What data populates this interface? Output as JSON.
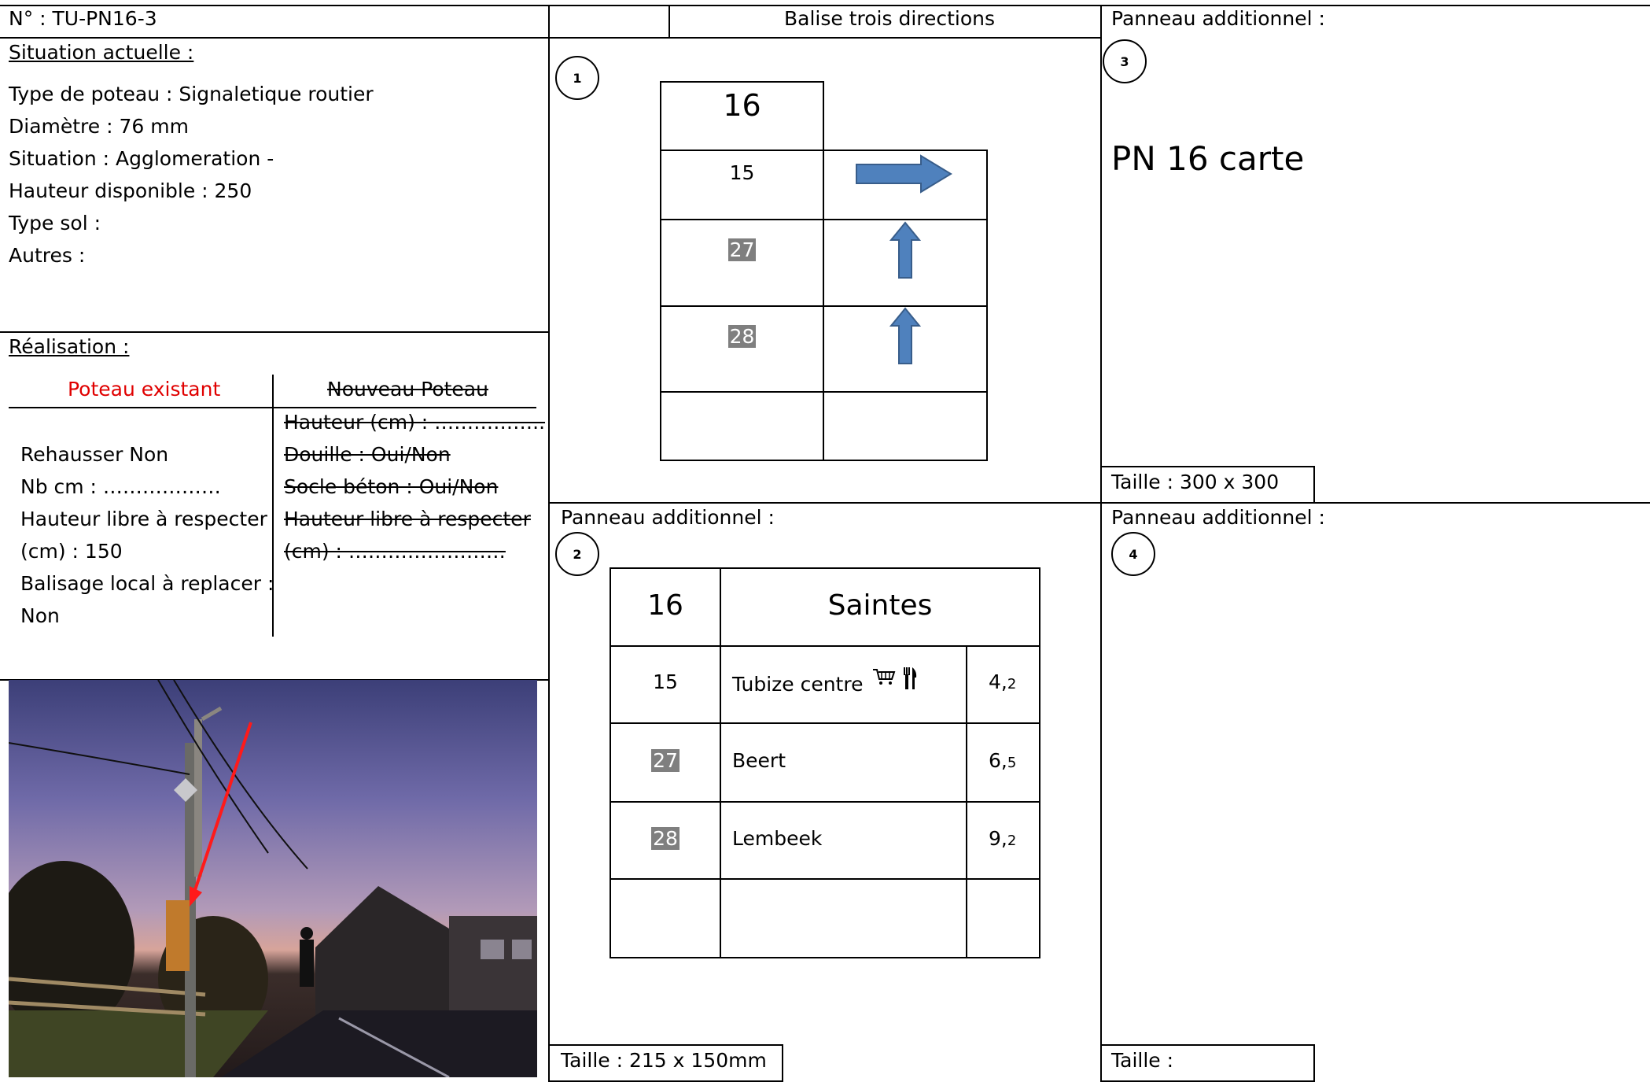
{
  "header": {
    "numero": "N° : TU-PN16-3",
    "balise_title": "Balise trois directions",
    "panneau3_title": "Panneau additionnel :"
  },
  "situation": {
    "heading": "Situation actuelle :",
    "lines": [
      "Type de poteau : Signaletique routier",
      "Diamètre : 76 mm",
      "Situation : Agglomeration -",
      "Hauteur disponible : 250",
      "Type sol :",
      "Autres :"
    ]
  },
  "realisation": {
    "heading": "Réalisation :",
    "col_existing": "Poteau existant",
    "col_new": "Nouveau Poteau",
    "existing_lines": [
      "Rehausser  Non",
      "Nb cm : ………………",
      "Hauteur libre à respecter",
      "(cm) : 150",
      "Balisage local à replacer :",
      " Non"
    ],
    "new_lines": [
      "Hauteur (cm) : ……………..",
      "Douille : Oui/Non",
      "Socle béton : Oui/Non",
      "Hauteur libre à respecter",
      "(cm) : ……………………"
    ]
  },
  "panel1": {
    "number": "1",
    "top": "16",
    "rows": [
      {
        "label": "15",
        "arrow": "right-arrow-icon"
      },
      {
        "label": "27",
        "arrow": "up-arrow-icon"
      },
      {
        "label": "28",
        "arrow": "up-arrow-icon"
      },
      {
        "label": "",
        "arrow": ""
      }
    ]
  },
  "panel2": {
    "title": "Panneau additionnel :",
    "number": "2",
    "head_num": "16",
    "head_dest": "Saintes",
    "rows": [
      {
        "num": "15",
        "dest": "Tubize centre",
        "icons": [
          "shopping-cart-icon",
          "restaurant-icon"
        ],
        "km_int": "4,",
        "km_dec": "2"
      },
      {
        "num": "27",
        "dest": "Beert",
        "icons": [],
        "km_int": "6,",
        "km_dec": "5"
      },
      {
        "num": "28",
        "dest": "Lembeek",
        "icons": [],
        "km_int": "9,",
        "km_dec": "2"
      },
      {
        "num": "",
        "dest": "",
        "icons": [],
        "km_int": "",
        "km_dec": ""
      }
    ],
    "size": "Taille : 215 x 150mm"
  },
  "panel3": {
    "number": "3",
    "big_text": "PN 16 carte",
    "size": "Taille : 300 x 300"
  },
  "panel4": {
    "title": "Panneau additionnel :",
    "number": "4",
    "size": "Taille :"
  },
  "colors": {
    "arrow_blue": "#4f81bd",
    "red_text": "#e00000",
    "grey_highlight": "#7f7f7f"
  }
}
